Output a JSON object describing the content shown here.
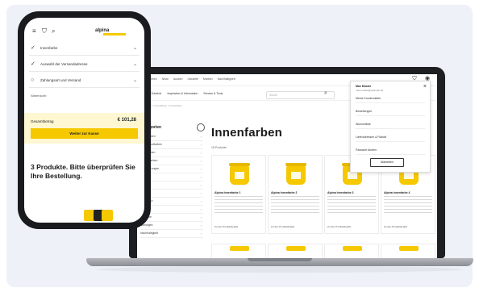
{
  "laptop": {
    "top_nav": [
      "Innenfarben",
      "Neue",
      "Aussen",
      "Garantie",
      "Marken",
      "Nachhaltigkeit"
    ],
    "sub_nav": [
      "Farbe & Zubehör",
      "Inspiration & Information",
      "Service & Tools"
    ],
    "search_placeholder": "Suche",
    "breadcrumb": "Startseite / Innenfarben / Innenfarben",
    "sidebar": {
      "heading": "Kategorien",
      "rows": [
        "Innenfarben",
        "Innenwandfarben",
        "Latexfarben",
        "Spezialfarben",
        "Grundierungen",
        "Lasuren",
        "Lacke",
        "Putze",
        "Reparatur",
        "Zubehör",
        "Farbtöne",
        "Sonstiges",
        "Nachhaltigkeit"
      ]
    },
    "page_title": "Innenfarben",
    "result_count": "18 Produkte",
    "products": [
      {
        "name": "Alpina Innenfarbe 1",
        "cta": "Zu den Produktdetails"
      },
      {
        "name": "Alpina Innenfarbe 2",
        "cta": "Zu den Produktdetails"
      },
      {
        "name": "Alpina Innenfarbe 3",
        "cta": "Zu den Produktdetails"
      },
      {
        "name": "Alpina Innenfarbe 4",
        "cta": "Zu den Produktdetails"
      }
    ],
    "account_menu": {
      "user_name": "Max Muster",
      "email": "max.muster@example.de",
      "items": [
        "Meine Kundendaten",
        "Bestellungen",
        "Wunschliste",
        "Lieferadressen & Rabatt",
        "Passwort ändern"
      ],
      "logout_label": "Abmelden"
    }
  },
  "phone": {
    "brand": "alpina",
    "rows": [
      {
        "label": "Innenfarbe",
        "check": "✓"
      },
      {
        "label": "Auswahl der Versandadresse",
        "check": "✓"
      },
      {
        "label": "Zahlungsart und Versand",
        "check": "○"
      }
    ],
    "note": "Warenkorb",
    "total_label": "Gesamtbetrag",
    "total_amount": "€ 101,28",
    "cta_label": "Weiter zur Kasse",
    "message": "3 Produkte. Bitte überprüfen Sie Ihre Bestellung."
  },
  "colors": {
    "accent": "#f5c800",
    "device_frame": "#1d1f23",
    "backdrop": "#eef1f7"
  },
  "icons": {
    "menu": "hamburger-icon",
    "cart": "cart-icon",
    "search": "search-icon",
    "user": "user-icon",
    "close": "close-icon",
    "chevron": "chevron-down-icon",
    "check": "check-icon"
  }
}
